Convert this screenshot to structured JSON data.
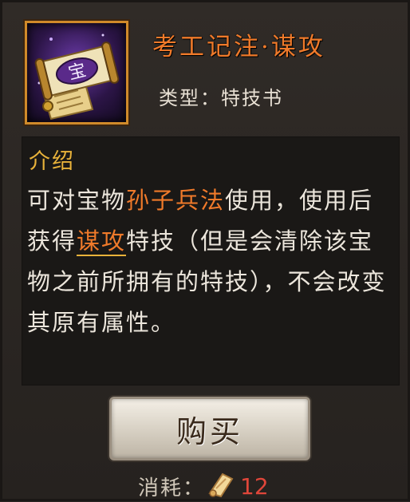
{
  "item": {
    "name": "考工记注·谋攻",
    "type_label": "类型：",
    "type_value": "特技书"
  },
  "description": {
    "heading": "介绍",
    "p1": "可对宝物",
    "target_item": "孙子兵法",
    "p2": "使用，使用后获得",
    "skill": "谋攻",
    "p3": "特技（但是会清除该宝物之前所拥有的特技），不会改变其原有属性。"
  },
  "buy": {
    "label": "购买"
  },
  "cost": {
    "label": "消耗：",
    "icon": "scroll-currency-icon",
    "value": "12"
  },
  "colors": {
    "title": "#f07a2a",
    "heading": "#e8b23a",
    "cost": "#e0463a"
  }
}
